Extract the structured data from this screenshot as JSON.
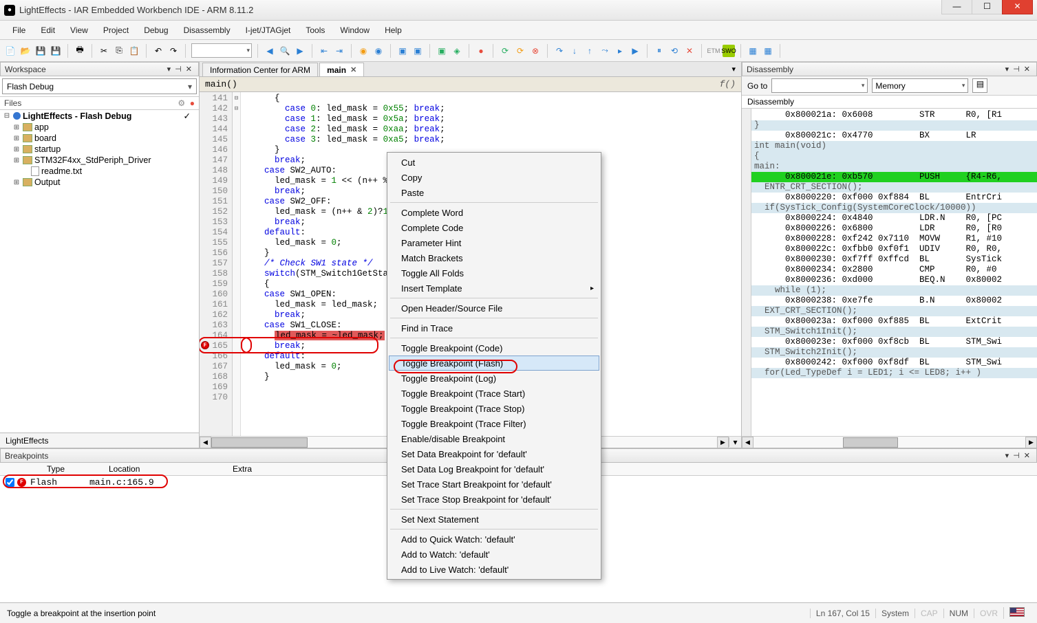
{
  "window": {
    "title": "LightEffects - IAR Embedded Workbench IDE - ARM 8.11.2"
  },
  "menu": {
    "items": [
      "File",
      "Edit",
      "View",
      "Project",
      "Debug",
      "Disassembly",
      "I-jet/JTAGjet",
      "Tools",
      "Window",
      "Help"
    ]
  },
  "workspace": {
    "title": "Workspace",
    "config": "Flash Debug",
    "files_label": "Files",
    "project": "LightEffects - Flash Debug",
    "folders": [
      "app",
      "board",
      "startup",
      "STM32F4xx_StdPeriph_Driver"
    ],
    "files": [
      "readme.txt"
    ],
    "output": "Output",
    "tab": "LightEffects"
  },
  "editor": {
    "tab_info": "Information Center for ARM",
    "tab_main": "main",
    "func": "main()",
    "fx": "f()",
    "lines": [
      {
        "n": 141,
        "t": "      {"
      },
      {
        "n": 142,
        "t": "        case 0: led_mask = 0x55; break;"
      },
      {
        "n": 143,
        "t": "        case 1: led_mask = 0x5a; break;"
      },
      {
        "n": 144,
        "t": "        case 2: led_mask = 0xaa; break;"
      },
      {
        "n": 145,
        "t": "        case 3: led_mask = 0xa5; break;"
      },
      {
        "n": 146,
        "t": "      }"
      },
      {
        "n": 147,
        "t": "      break;"
      },
      {
        "n": 148,
        "t": "    case SW2_AUTO:"
      },
      {
        "n": 149,
        "t": "      led_mask = 1 << (n++ %"
      },
      {
        "n": 150,
        "t": "      break;"
      },
      {
        "n": 151,
        "t": "    case SW2_OFF:"
      },
      {
        "n": 152,
        "t": "      led_mask = (n++ & 2)?1"
      },
      {
        "n": 153,
        "t": "      break;"
      },
      {
        "n": 154,
        "t": "    default:"
      },
      {
        "n": 155,
        "t": "      led_mask = 0;"
      },
      {
        "n": 156,
        "t": "    }"
      },
      {
        "n": 157,
        "t": ""
      },
      {
        "n": 158,
        "t": "    /* Check SW1 state */"
      },
      {
        "n": 159,
        "t": "    switch(STM_Switch1GetState"
      },
      {
        "n": 160,
        "t": "    {"
      },
      {
        "n": 161,
        "t": "    case SW1_OPEN:"
      },
      {
        "n": 162,
        "t": "      led_mask = led_mask;"
      },
      {
        "n": 163,
        "t": "      break;"
      },
      {
        "n": 164,
        "t": "    case SW1_CLOSE:"
      },
      {
        "n": 165,
        "t": "      led_mask = ~led_mask;"
      },
      {
        "n": 166,
        "t": "      break;"
      },
      {
        "n": 167,
        "t": "    default:"
      },
      {
        "n": 168,
        "t": "      led_mask = 0;"
      },
      {
        "n": 169,
        "t": "    }"
      },
      {
        "n": 170,
        "t": ""
      }
    ]
  },
  "context_menu": {
    "items1": [
      "Cut",
      "Copy",
      "Paste"
    ],
    "items2": [
      "Complete Word",
      "Complete Code",
      "Parameter Hint",
      "Match Brackets",
      "Toggle All Folds",
      "Insert Template"
    ],
    "items3": [
      "Open Header/Source File"
    ],
    "items4": [
      "Find in Trace"
    ],
    "items5": [
      "Toggle Breakpoint (Code)",
      "Toggle Breakpoint (Flash)",
      "Toggle Breakpoint (Log)",
      "Toggle Breakpoint (Trace Start)",
      "Toggle Breakpoint (Trace Stop)",
      "Toggle Breakpoint (Trace Filter)",
      "Enable/disable Breakpoint",
      "Set Data Breakpoint for 'default'",
      "Set Data Log Breakpoint for 'default'",
      "Set Trace Start Breakpoint for 'default'",
      "Set Trace Stop Breakpoint for 'default'"
    ],
    "items6": [
      "Set Next Statement"
    ],
    "items7": [
      "Add to Quick Watch:  'default'",
      "Add to Watch: 'default'",
      "Add to Live Watch: 'default'"
    ]
  },
  "disasm": {
    "title": "Disassembly",
    "goto": "Go to",
    "memory": "Memory",
    "sub": "Disassembly",
    "lines": [
      {
        "src": false,
        "t": "      0x800021a: 0x6008         STR      R0, [R1"
      },
      {
        "src": true,
        "t": "}"
      },
      {
        "src": false,
        "t": "      0x800021c: 0x4770         BX       LR"
      },
      {
        "src": true,
        "t": "int main(void)"
      },
      {
        "src": true,
        "t": "{"
      },
      {
        "src": true,
        "t": "main:"
      },
      {
        "src": false,
        "hl": true,
        "t": "      0x800021e: 0xb570         PUSH     {R4-R6,"
      },
      {
        "src": true,
        "t": "  ENTR_CRT_SECTION();"
      },
      {
        "src": false,
        "t": "      0x8000220: 0xf000 0xf884  BL       EntrCri"
      },
      {
        "src": true,
        "t": "  if(SysTick_Config(SystemCoreClock/10000))"
      },
      {
        "src": false,
        "t": "      0x8000224: 0x4840         LDR.N    R0, [PC"
      },
      {
        "src": false,
        "t": "      0x8000226: 0x6800         LDR      R0, [R0"
      },
      {
        "src": false,
        "t": "      0x8000228: 0xf242 0x7110  MOVW     R1, #10"
      },
      {
        "src": false,
        "t": "      0x800022c: 0xfbb0 0xf0f1  UDIV     R0, R0,"
      },
      {
        "src": false,
        "t": "      0x8000230: 0xf7ff 0xffcd  BL       SysTick"
      },
      {
        "src": false,
        "t": "      0x8000234: 0x2800         CMP      R0, #0"
      },
      {
        "src": false,
        "t": "      0x8000236: 0xd000         BEQ.N    0x80002"
      },
      {
        "src": true,
        "t": "    while (1);"
      },
      {
        "src": false,
        "t": "      0x8000238: 0xe7fe         B.N      0x80002"
      },
      {
        "src": true,
        "t": "  EXT_CRT_SECTION();"
      },
      {
        "src": false,
        "t": "      0x800023a: 0xf000 0xf885  BL       ExtCrit"
      },
      {
        "src": true,
        "t": "  STM_Switch1Init();"
      },
      {
        "src": false,
        "t": "      0x800023e: 0xf000 0xf8cb  BL       STM_Swi"
      },
      {
        "src": true,
        "t": "  STM_Switch2Init();"
      },
      {
        "src": false,
        "t": "      0x8000242: 0xf000 0xf8df  BL       STM_Swi"
      },
      {
        "src": true,
        "t": "  for(Led_TypeDef i = LED1; i <= LED8; i++ )"
      }
    ]
  },
  "breakpoints": {
    "title": "Breakpoints",
    "cols": [
      "Type",
      "Location",
      "Extra"
    ],
    "row": {
      "type": "Flash",
      "loc": "main.c:165.9"
    }
  },
  "status": {
    "hint": "Toggle a breakpoint at the insertion point",
    "pos": "Ln 167, Col 15",
    "sys": "System",
    "cap": "CAP",
    "num": "NUM",
    "ovr": "OVR"
  }
}
